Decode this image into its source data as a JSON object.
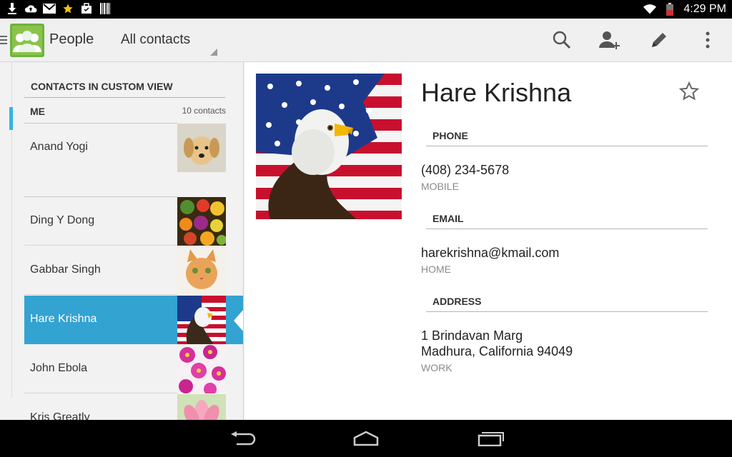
{
  "status_bar": {
    "time": "4:29 PM",
    "left_icons": [
      "download-icon",
      "cloud-upload-icon",
      "gmail-icon",
      "star-icon",
      "bag-icon",
      "barcode-icon"
    ],
    "right_icons": [
      "wifi-icon",
      "battery-icon"
    ]
  },
  "action_bar": {
    "app_title": "People",
    "view_filter": "All contacts",
    "actions": [
      "search-icon",
      "add-contact-icon",
      "edit-icon",
      "overflow-menu-icon"
    ]
  },
  "contact_list": {
    "section_header": "CONTACTS IN CUSTOM VIEW",
    "me_label": "ME",
    "me_count": "10 contacts",
    "contacts": [
      {
        "name": "Anand Yogi",
        "photo": "puppy"
      },
      {
        "name": "Ding Y Dong",
        "photo": "fruits"
      },
      {
        "name": "Gabbar Singh",
        "photo": "kitten"
      },
      {
        "name": "Hare Krishna",
        "photo": "eagle-flag",
        "selected": true
      },
      {
        "name": "John Ebola",
        "photo": "pink-flowers"
      },
      {
        "name": "Kris Greatly",
        "photo": "lotus"
      }
    ]
  },
  "detail": {
    "name": "Hare Krishna",
    "phone": {
      "header": "PHONE",
      "value": "(408) 234-5678",
      "type": "MOBILE"
    },
    "email": {
      "header": "EMAIL",
      "value": "harekrishna@kmail.com",
      "type": "HOME"
    },
    "address": {
      "header": "ADDRESS",
      "line1": "1 Brindavan Marg",
      "line2": "Madhura, California 94049",
      "type": "WORK"
    }
  },
  "nav_bar": [
    "back-icon",
    "home-icon",
    "recents-icon"
  ],
  "colors": {
    "accent": "#33b5e5",
    "selected_row": "#33a3d1",
    "status_bar": "#000000"
  }
}
